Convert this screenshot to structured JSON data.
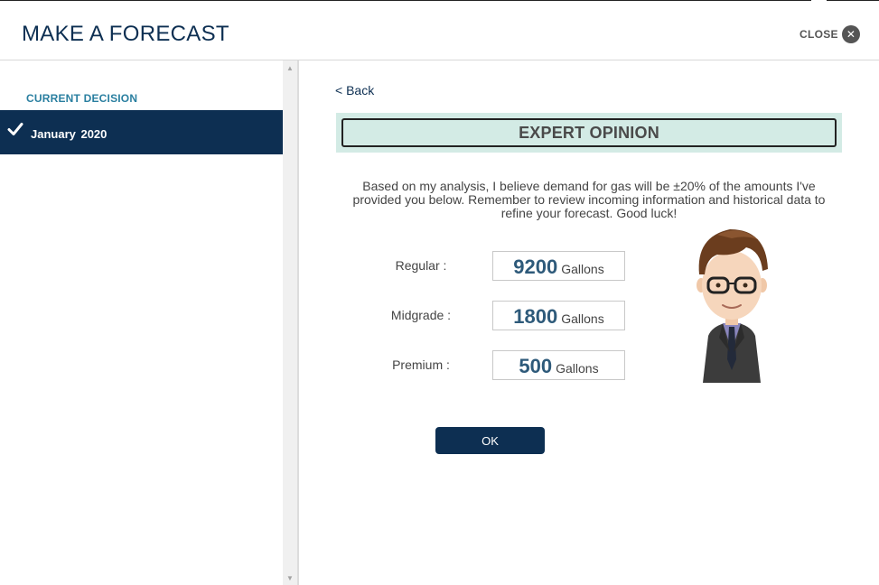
{
  "header": {
    "title": "MAKE A FORECAST",
    "close_label": "CLOSE"
  },
  "sidebar": {
    "section_label": "CURRENT DECISION",
    "current_decision": {
      "label": "January  2020",
      "completed": true
    }
  },
  "main": {
    "back_label": "< Back",
    "banner_title": "EXPERT OPINION",
    "description": "Based on my analysis, I believe demand for gas will be ±20% of the amounts I've provided you below. Remember to review incoming information and historical data to refine your forecast. Good luck!",
    "forecasts": [
      {
        "label": "Regular :",
        "value": "9200",
        "unit": "Gallons"
      },
      {
        "label": "Midgrade :",
        "value": "1800",
        "unit": "Gallons"
      },
      {
        "label": "Premium :",
        "value": "500",
        "unit": "Gallons"
      }
    ],
    "ok_label": "OK"
  },
  "colors": {
    "primary_navy": "#0d2f52",
    "accent_teal": "#2a7fa0",
    "banner_bg": "#d3ebe5",
    "value_blue": "#2e5a7a"
  }
}
